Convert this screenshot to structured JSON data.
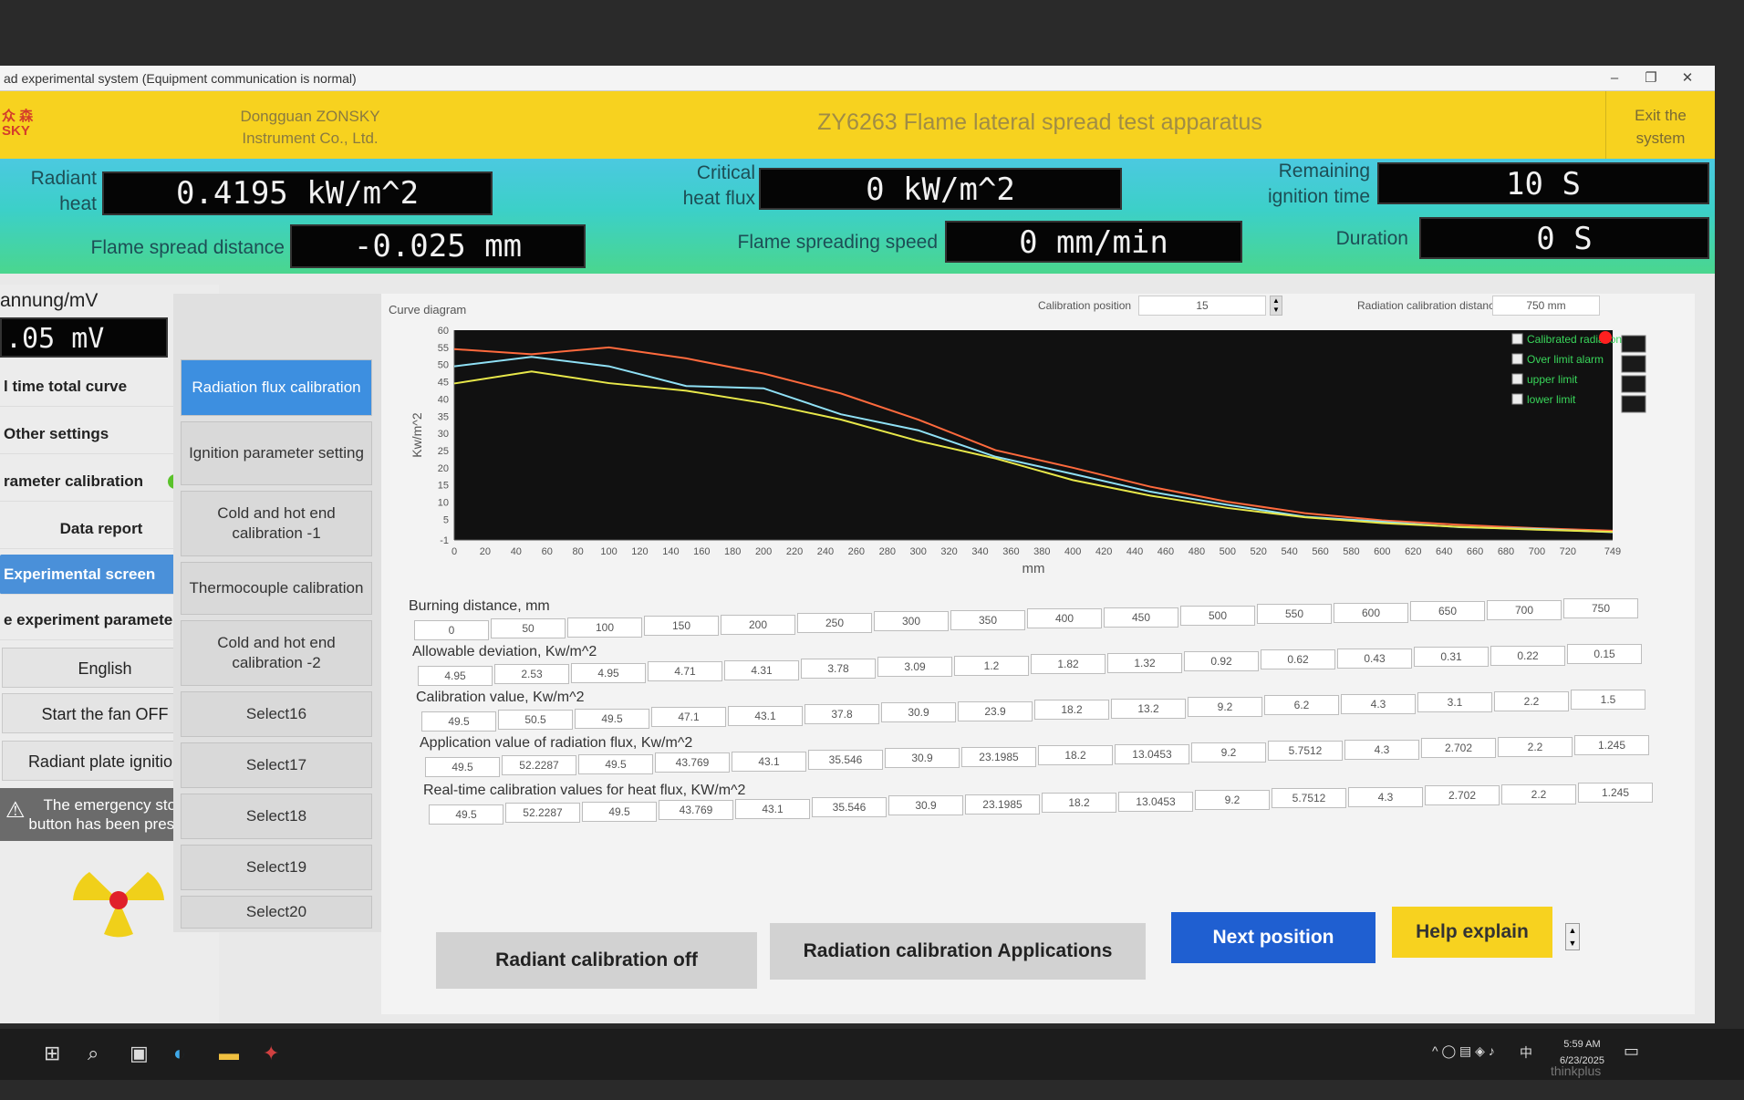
{
  "window": {
    "title": "ad experimental system (Equipment communication is normal)",
    "controls": [
      "–",
      "❐",
      "✕"
    ]
  },
  "header": {
    "logo_line1": "众 森",
    "logo_line2": "SKY",
    "company_line1": "Dongguan ZONSKY",
    "company_line2": "Instrument Co., Ltd.",
    "app_title": "ZY6263 Flame lateral spread test apparatus",
    "exit_line1": "Exit the",
    "exit_line2": "system"
  },
  "measurements": {
    "radiant_heat_label1": "Radiant",
    "radiant_heat_label2": "heat",
    "radiant_heat_value": "0.4195 kW/m^2",
    "critical_label1": "Critical",
    "critical_label2": "heat flux",
    "critical_value": "0 kW/m^2",
    "remaining_label1": "Remaining",
    "remaining_label2": "ignition time",
    "remaining_value": "10 S",
    "spread_distance_label": "Flame spread distance",
    "spread_distance_value": "-0.025 mm",
    "spread_speed_label": "Flame spreading speed",
    "spread_speed_value": "0 mm/min",
    "duration_label": "Duration",
    "duration_value": "0 S"
  },
  "left": {
    "voltage_label": "annung/mV",
    "voltage_value": ".05 mV",
    "nav": [
      "l time total curve",
      "Other settings",
      "rameter calibration",
      "Data report",
      "Experimental screen",
      "e experiment parameters"
    ],
    "buttons": [
      "English",
      "Start the fan OFF",
      "Radiant plate ignition"
    ],
    "emergency_line1": "The emergency stop",
    "emergency_line2": "button has been pressed",
    "status_color": "#5ac22a"
  },
  "submenu": [
    "Radiation flux calibration",
    "Ignition parameter setting",
    "Cold and hot end calibration -1",
    "Thermocouple calibration",
    "Cold and hot end calibration -2",
    "Select16",
    "Select17",
    "Select18",
    "Select19",
    "Select20"
  ],
  "chart_header": {
    "curve_label": "Curve diagram",
    "calib_pos_label": "Calibration position",
    "calib_pos_value": "15",
    "calib_dist_label": "Radiation calibration distance",
    "calib_dist_value": "750 mm"
  },
  "chart_data": {
    "type": "line",
    "ylabel": "Kw/m^2",
    "xlabel": "mm",
    "ylim": [
      -1,
      60
    ],
    "xlim": [
      0,
      749
    ],
    "y_ticks": [
      60,
      55,
      50,
      45,
      40,
      35,
      30,
      25,
      20,
      15,
      10,
      5,
      -1
    ],
    "x_ticks": [
      0,
      20,
      40,
      60,
      80,
      100,
      120,
      140,
      160,
      180,
      200,
      220,
      240,
      260,
      280,
      300,
      320,
      340,
      360,
      380,
      400,
      420,
      440,
      460,
      480,
      500,
      520,
      540,
      560,
      580,
      600,
      620,
      640,
      660,
      680,
      700,
      720,
      749
    ],
    "legend": [
      "Calibrated radiation",
      "Over limit alarm",
      "upper limit",
      "lower limit"
    ],
    "series": [
      {
        "name": "upper limit",
        "color": "#ff6a3d",
        "x": [
          0,
          50,
          100,
          150,
          200,
          250,
          300,
          350,
          400,
          450,
          500,
          550,
          600,
          650,
          700,
          749
        ],
        "y": [
          54.5,
          53.0,
          55.0,
          51.8,
          47.4,
          41.6,
          34.0,
          25.1,
          20.0,
          14.5,
          10.1,
          6.8,
          4.7,
          3.4,
          2.4,
          1.7
        ]
      },
      {
        "name": "Calibrated radiation",
        "color": "#8fe0f5",
        "x": [
          0,
          50,
          100,
          150,
          200,
          250,
          300,
          350,
          400,
          450,
          500,
          550,
          600,
          650,
          700,
          749
        ],
        "y": [
          49.5,
          52.2287,
          49.5,
          43.769,
          43.1,
          35.546,
          30.9,
          23.1985,
          18.2,
          13.0453,
          9.2,
          5.7512,
          4.3,
          2.702,
          2.2,
          1.245
        ]
      },
      {
        "name": "lower limit",
        "color": "#e8e84a",
        "x": [
          0,
          50,
          100,
          150,
          200,
          250,
          300,
          350,
          400,
          450,
          500,
          550,
          600,
          650,
          700,
          749
        ],
        "y": [
          44.5,
          48.0,
          44.6,
          42.4,
          38.8,
          34.0,
          27.8,
          22.7,
          16.4,
          11.9,
          8.3,
          5.6,
          3.9,
          2.8,
          2.0,
          1.35
        ]
      }
    ]
  },
  "table": {
    "rows": [
      {
        "label": "Burning distance, mm",
        "values": [
          "0",
          "50",
          "100",
          "150",
          "200",
          "250",
          "300",
          "350",
          "400",
          "450",
          "500",
          "550",
          "600",
          "650",
          "700",
          "750"
        ]
      },
      {
        "label": "Allowable deviation, Kw/m^2",
        "values": [
          "4.95",
          "2.53",
          "4.95",
          "4.71",
          "4.31",
          "3.78",
          "3.09",
          "1.2",
          "1.82",
          "1.32",
          "0.92",
          "0.62",
          "0.43",
          "0.31",
          "0.22",
          "0.15"
        ]
      },
      {
        "label": "Calibration value, Kw/m^2",
        "values": [
          "49.5",
          "50.5",
          "49.5",
          "47.1",
          "43.1",
          "37.8",
          "30.9",
          "23.9",
          "18.2",
          "13.2",
          "9.2",
          "6.2",
          "4.3",
          "3.1",
          "2.2",
          "1.5"
        ]
      },
      {
        "label": "Application value of radiation flux, Kw/m^2",
        "values": [
          "49.5",
          "52.2287",
          "49.5",
          "43.769",
          "43.1",
          "35.546",
          "30.9",
          "23.1985",
          "18.2",
          "13.0453",
          "9.2",
          "5.7512",
          "4.3",
          "2.702",
          "2.2",
          "1.245"
        ]
      },
      {
        "label": "Real-time calibration values for heat flux,   KW/m^2",
        "values": [
          "49.5",
          "52.2287",
          "49.5",
          "43.769",
          "43.1",
          "35.546",
          "30.9",
          "23.1985",
          "18.2",
          "13.0453",
          "9.2",
          "5.7512",
          "4.3",
          "2.702",
          "2.2",
          "1.245"
        ]
      }
    ]
  },
  "actions": {
    "calib_off": "Radiant calibration off",
    "calib_apps": "Radiation calibration Applications",
    "next": "Next position",
    "help": "Help explain"
  },
  "taskbar": {
    "time": "5:59 AM",
    "date": "6/23/2025",
    "brand": "thinkplus",
    "ime": "中"
  }
}
